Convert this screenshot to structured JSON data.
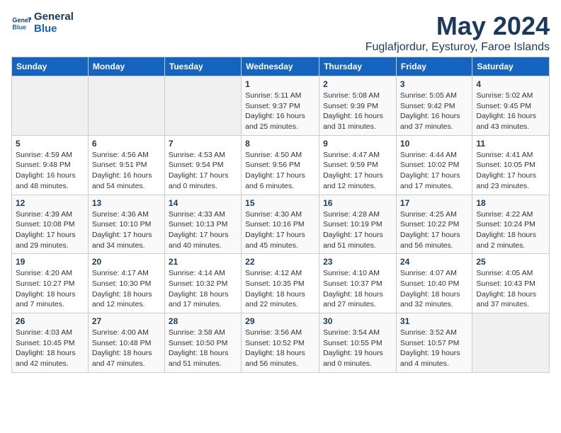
{
  "logo": {
    "line1": "General",
    "line2": "Blue"
  },
  "title": "May 2024",
  "location": "Fuglafjordur, Eysturoy, Faroe Islands",
  "weekdays": [
    "Sunday",
    "Monday",
    "Tuesday",
    "Wednesday",
    "Thursday",
    "Friday",
    "Saturday"
  ],
  "weeks": [
    [
      {
        "day": "",
        "info": ""
      },
      {
        "day": "",
        "info": ""
      },
      {
        "day": "",
        "info": ""
      },
      {
        "day": "1",
        "info": "Sunrise: 5:11 AM\nSunset: 9:37 PM\nDaylight: 16 hours\nand 25 minutes."
      },
      {
        "day": "2",
        "info": "Sunrise: 5:08 AM\nSunset: 9:39 PM\nDaylight: 16 hours\nand 31 minutes."
      },
      {
        "day": "3",
        "info": "Sunrise: 5:05 AM\nSunset: 9:42 PM\nDaylight: 16 hours\nand 37 minutes."
      },
      {
        "day": "4",
        "info": "Sunrise: 5:02 AM\nSunset: 9:45 PM\nDaylight: 16 hours\nand 43 minutes."
      }
    ],
    [
      {
        "day": "5",
        "info": "Sunrise: 4:59 AM\nSunset: 9:48 PM\nDaylight: 16 hours\nand 48 minutes."
      },
      {
        "day": "6",
        "info": "Sunrise: 4:56 AM\nSunset: 9:51 PM\nDaylight: 16 hours\nand 54 minutes."
      },
      {
        "day": "7",
        "info": "Sunrise: 4:53 AM\nSunset: 9:54 PM\nDaylight: 17 hours\nand 0 minutes."
      },
      {
        "day": "8",
        "info": "Sunrise: 4:50 AM\nSunset: 9:56 PM\nDaylight: 17 hours\nand 6 minutes."
      },
      {
        "day": "9",
        "info": "Sunrise: 4:47 AM\nSunset: 9:59 PM\nDaylight: 17 hours\nand 12 minutes."
      },
      {
        "day": "10",
        "info": "Sunrise: 4:44 AM\nSunset: 10:02 PM\nDaylight: 17 hours\nand 17 minutes."
      },
      {
        "day": "11",
        "info": "Sunrise: 4:41 AM\nSunset: 10:05 PM\nDaylight: 17 hours\nand 23 minutes."
      }
    ],
    [
      {
        "day": "12",
        "info": "Sunrise: 4:39 AM\nSunset: 10:08 PM\nDaylight: 17 hours\nand 29 minutes."
      },
      {
        "day": "13",
        "info": "Sunrise: 4:36 AM\nSunset: 10:10 PM\nDaylight: 17 hours\nand 34 minutes."
      },
      {
        "day": "14",
        "info": "Sunrise: 4:33 AM\nSunset: 10:13 PM\nDaylight: 17 hours\nand 40 minutes."
      },
      {
        "day": "15",
        "info": "Sunrise: 4:30 AM\nSunset: 10:16 PM\nDaylight: 17 hours\nand 45 minutes."
      },
      {
        "day": "16",
        "info": "Sunrise: 4:28 AM\nSunset: 10:19 PM\nDaylight: 17 hours\nand 51 minutes."
      },
      {
        "day": "17",
        "info": "Sunrise: 4:25 AM\nSunset: 10:22 PM\nDaylight: 17 hours\nand 56 minutes."
      },
      {
        "day": "18",
        "info": "Sunrise: 4:22 AM\nSunset: 10:24 PM\nDaylight: 18 hours\nand 2 minutes."
      }
    ],
    [
      {
        "day": "19",
        "info": "Sunrise: 4:20 AM\nSunset: 10:27 PM\nDaylight: 18 hours\nand 7 minutes."
      },
      {
        "day": "20",
        "info": "Sunrise: 4:17 AM\nSunset: 10:30 PM\nDaylight: 18 hours\nand 12 minutes."
      },
      {
        "day": "21",
        "info": "Sunrise: 4:14 AM\nSunset: 10:32 PM\nDaylight: 18 hours\nand 17 minutes."
      },
      {
        "day": "22",
        "info": "Sunrise: 4:12 AM\nSunset: 10:35 PM\nDaylight: 18 hours\nand 22 minutes."
      },
      {
        "day": "23",
        "info": "Sunrise: 4:10 AM\nSunset: 10:37 PM\nDaylight: 18 hours\nand 27 minutes."
      },
      {
        "day": "24",
        "info": "Sunrise: 4:07 AM\nSunset: 10:40 PM\nDaylight: 18 hours\nand 32 minutes."
      },
      {
        "day": "25",
        "info": "Sunrise: 4:05 AM\nSunset: 10:43 PM\nDaylight: 18 hours\nand 37 minutes."
      }
    ],
    [
      {
        "day": "26",
        "info": "Sunrise: 4:03 AM\nSunset: 10:45 PM\nDaylight: 18 hours\nand 42 minutes."
      },
      {
        "day": "27",
        "info": "Sunrise: 4:00 AM\nSunset: 10:48 PM\nDaylight: 18 hours\nand 47 minutes."
      },
      {
        "day": "28",
        "info": "Sunrise: 3:58 AM\nSunset: 10:50 PM\nDaylight: 18 hours\nand 51 minutes."
      },
      {
        "day": "29",
        "info": "Sunrise: 3:56 AM\nSunset: 10:52 PM\nDaylight: 18 hours\nand 56 minutes."
      },
      {
        "day": "30",
        "info": "Sunrise: 3:54 AM\nSunset: 10:55 PM\nDaylight: 19 hours\nand 0 minutes."
      },
      {
        "day": "31",
        "info": "Sunrise: 3:52 AM\nSunset: 10:57 PM\nDaylight: 19 hours\nand 4 minutes."
      },
      {
        "day": "",
        "info": ""
      }
    ]
  ]
}
